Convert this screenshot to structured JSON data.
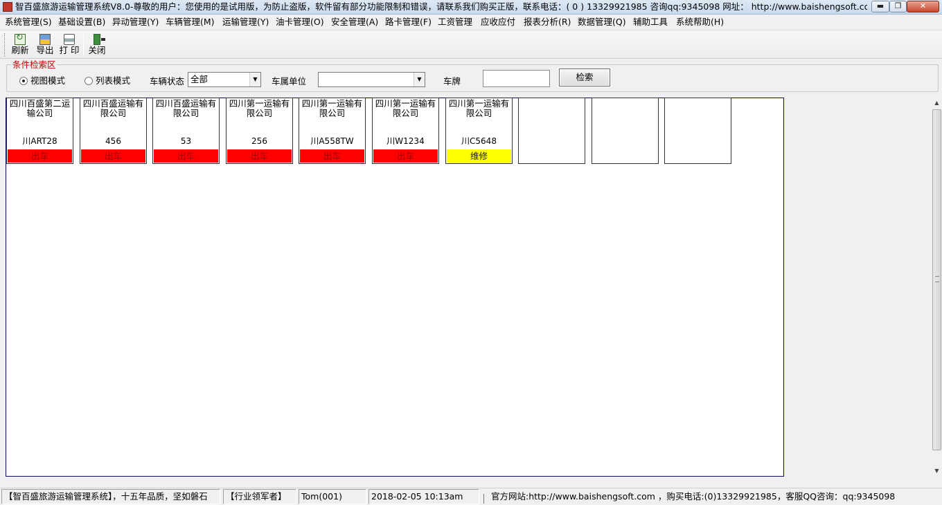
{
  "window": {
    "title": "智百盛旅游运输管理系统V8.0-尊敬的用户：您使用的是试用版，为防止盗版，软件留有部分功能限制和错误，请联系我们购买正版，联系电话：( 0 ) 13329921985  咨询qq:9345098   网址： http://www.baishengsoft.com - [...",
    "minimize_glyph": "▬",
    "maximize_glyph": "❐",
    "close_glyph": "✕"
  },
  "menu": [
    "系统管理(S)",
    "基础设置(B)",
    "异动管理(Y)",
    "车辆管理(M)",
    "运输管理(Y)",
    "油卡管理(O)",
    "安全管理(A)",
    "路卡管理(F)",
    "工资管理",
    "应收应付",
    "报表分析(R)",
    "数据管理(Q)",
    "辅助工具",
    "系统帮助(H)"
  ],
  "toolbar": {
    "refresh_label": "刷新",
    "export_label": "导出",
    "print_label": "打 印",
    "close_label": "关闭"
  },
  "search": {
    "legend": "条件检索区",
    "mode_view_label": "视图模式",
    "mode_list_label": "列表模式",
    "selected_mode": "视图模式",
    "vehicle_status_label": "车辆状态",
    "vehicle_status_value": "全部",
    "unit_label": "车属单位",
    "unit_value": "",
    "plate_label": "车牌",
    "plate_value": "",
    "search_button": "检索"
  },
  "vehicles": [
    {
      "company": "四川百盛第二运输公司",
      "plate": "川ART28",
      "status": "出车",
      "status_color": "#ff0000"
    },
    {
      "company": "四川百盛运输有限公司",
      "plate": "456",
      "status": "出车",
      "status_color": "#ff0000"
    },
    {
      "company": "四川百盛运输有限公司",
      "plate": "53",
      "status": "出车",
      "status_color": "#ff0000"
    },
    {
      "company": "四川第一运输有限公司",
      "plate": "256",
      "status": "出车",
      "status_color": "#ff0000"
    },
    {
      "company": "四川第一运输有限公司",
      "plate": "川A558TW",
      "status": "出车",
      "status_color": "#ff0000"
    },
    {
      "company": "四川第一运输有限公司",
      "plate": "川W1234",
      "status": "出车",
      "status_color": "#ff0000"
    },
    {
      "company": "四川第一运输有限公司",
      "plate": "川C5648",
      "status": "维修",
      "status_color": "#ffff00"
    },
    {
      "company": "",
      "plate": "",
      "status": "",
      "status_color": ""
    },
    {
      "company": "",
      "plate": "",
      "status": "",
      "status_color": ""
    },
    {
      "company": "",
      "plate": "",
      "status": "",
      "status_color": ""
    }
  ],
  "statusbar": {
    "slogan": "【智百盛旅游运输管理系统】，十五年品质，坚如磐石",
    "leader": "【行业领军者】",
    "user": "Tom(001)",
    "datetime": "2018-02-05 10:13am",
    "contact": "官方网站:http://www.baishengsoft.com ，购买电话:(0)13329921985，客服QQ咨询：qq:9345098"
  },
  "colors": {
    "status_out": "#ff0000",
    "status_repair": "#ffff00",
    "legend": "#c00000",
    "panel_border": "#0a0a6a"
  }
}
